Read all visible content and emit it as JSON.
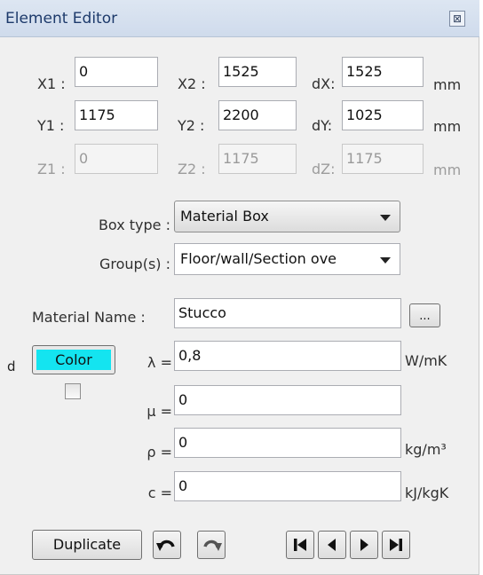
{
  "window": {
    "title": "Element Editor",
    "close_glyph": "⊠"
  },
  "coords": {
    "x1": {
      "label": "X1 :",
      "value": "0"
    },
    "x2": {
      "label": "X2 :",
      "value": "1525"
    },
    "dx": {
      "label": "dX:",
      "value": "1525",
      "unit": "mm"
    },
    "y1": {
      "label": "Y1 :",
      "value": "1175"
    },
    "y2": {
      "label": "Y2 :",
      "value": "2200"
    },
    "dy": {
      "label": "dY:",
      "value": "1025",
      "unit": "mm"
    },
    "z1": {
      "label": "Z1 :",
      "value": "0"
    },
    "z2": {
      "label": "Z2 :",
      "value": "1175"
    },
    "dz": {
      "label": "dZ:",
      "value": "1175",
      "unit": "mm"
    }
  },
  "box_type": {
    "label": "Box type :",
    "value": "Material Box"
  },
  "groups": {
    "label": "Group(s) :",
    "value": "Floor/wall/Section ove"
  },
  "material": {
    "label": "Material Name :",
    "value": "Stucco",
    "browse_label": "..."
  },
  "color_button": {
    "label": "Color",
    "swatch": "#14e4f0"
  },
  "properties": {
    "lambda": {
      "label": "λ =",
      "value": "0,8",
      "unit": "W/mK"
    },
    "mu": {
      "label": "μ =",
      "value": "0",
      "unit": ""
    },
    "rho": {
      "label": "ρ =",
      "value": "0",
      "unit": "kg/m³"
    },
    "c": {
      "label": "c =",
      "value": "0",
      "unit": "kJ/kgK"
    }
  },
  "footer": {
    "duplicate_label": "Duplicate"
  },
  "background_fragment": "d",
  "icons": [
    "close-icon",
    "undo-icon",
    "redo-icon",
    "first-record-icon",
    "previous-record-icon",
    "next-record-icon",
    "last-record-icon",
    "dropdown-arrow-icon"
  ]
}
